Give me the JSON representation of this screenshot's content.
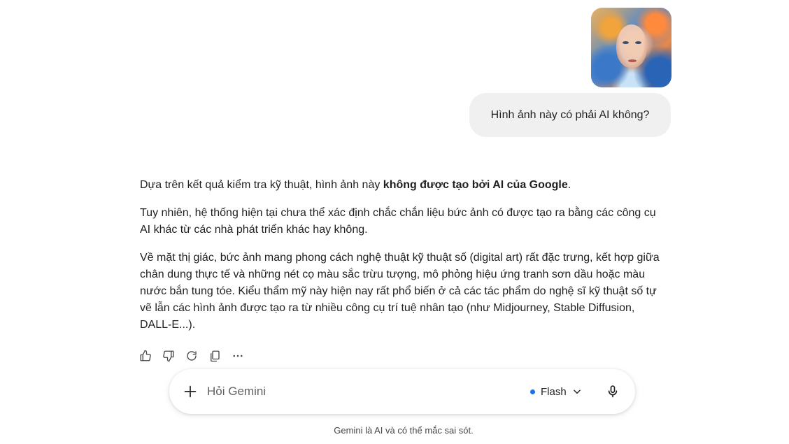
{
  "conversation": {
    "user_image": {
      "icon": "portrait-photo",
      "colors": [
        "#f0b25a",
        "#4c86cf",
        "#e7894a",
        "#254f9c"
      ]
    },
    "user_message": "Hình ảnh này có phải AI không?",
    "response": {
      "p1_prefix": "Dựa trên kết quả kiểm tra kỹ thuật, hình ảnh này ",
      "p1_bold": "không được tạo bởi AI của Google",
      "p1_suffix": ".",
      "p2": "Tuy nhiên, hệ thống hiện tại chưa thể xác định chắc chắn liệu bức ảnh có được tạo ra bằng các công cụ AI khác từ các nhà phát triển khác hay không.",
      "p3": "Về mặt thị giác, bức ảnh mang phong cách nghệ thuật kỹ thuật số (digital art) rất đặc trưng, kết hợp giữa chân dung thực tế và những nét cọ màu sắc trừu tượng, mô phỏng hiệu ứng tranh sơn dầu hoặc màu nước bắn tung tóe. Kiểu thẩm mỹ này hiện nay rất phổ biến ở cả các tác phẩm do nghệ sĩ kỹ thuật số tự vẽ lẫn các hình ảnh được tạo ra từ nhiều công cụ trí tuệ nhân tạo (như Midjourney, Stable Diffusion, DALL-E...)."
    },
    "actions": [
      "thumbs-up-icon",
      "thumbs-down-icon",
      "regenerate-icon",
      "copy-icon",
      "more-icon"
    ]
  },
  "input": {
    "placeholder": "Hỏi Gemini",
    "model_label": "Flash",
    "model_dot_color": "#1a73e8"
  },
  "footer": {
    "disclaimer": "Gemini là AI và có thể mắc sai sót."
  }
}
